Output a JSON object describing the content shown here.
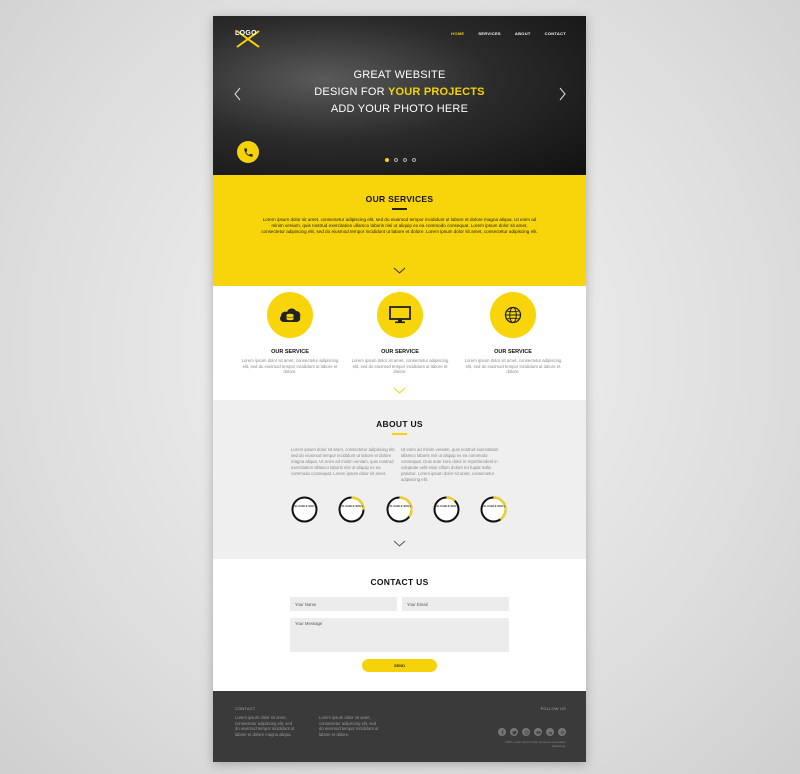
{
  "brand": {
    "logo_text": "LOGO"
  },
  "nav": {
    "items": [
      "HOME",
      "SERVICES",
      "ABOUT",
      "CONTACT"
    ],
    "active": "HOME"
  },
  "hero": {
    "line1": "GREAT WEBSITE",
    "line2_prefix": "DESIGN FOR ",
    "line2_highlight": "YOUR PROJECTS",
    "line3": "ADD YOUR PHOTO HERE",
    "prev_icon": "chevron-left-icon",
    "next_icon": "chevron-right-icon",
    "phone_icon": "phone-icon",
    "slides": 4,
    "active_slide": 1
  },
  "services": {
    "title": "OUR SERVICES",
    "text": "Lorem ipsum dolor sit amet, consectetur adipiscing elit, sed do eiusmod tempor incididunt ut labore et dolore magna aliqua. Ut enim ad minim veniam, quis nostrud exercitation ullamco laboris nisi ut aliquip ex ea commodo consequat. Lorem ipsum dolor sit amet, consectetur adipiscing elit, sed do eiusmod tempor incididunt ut labore et dolore. Lorem ipsum dolor sit amet, consectetur adipiscing elit.",
    "items": [
      {
        "icon": "cloud-database-icon",
        "title": "OUR SERVICE",
        "text": "Lorem ipsum dolor sit amet, consectetur adipiscing elit, sed do eiusmod tempor incididunt ut labore et dolore."
      },
      {
        "icon": "monitor-icon",
        "title": "OUR SERVICE",
        "text": "Lorem ipsum dolor sit amet, consectetur adipiscing elit, sed do eiusmod tempor incididunt ut labore et dolore."
      },
      {
        "icon": "globe-icon",
        "title": "OUR SERVICE",
        "text": "Lorem ipsum dolor sit amet, consectetur adipiscing elit, sed do eiusmod tempor incididunt ut labore et dolore."
      }
    ]
  },
  "about": {
    "title": "ABOUT US",
    "col1": "Lorem ipsum dolor sit amet, consectetur adipiscing elit, sed do eiusmod tempor incididunt ut labore et dolore magna aliqua. Ut enim ad minim veniam, quis nostrud exercitation ullamco laboris nisi ut aliquip ex ea commodo consequat. Lorem ipsum dolor sit amet.",
    "col2": "Ut enim ad minim veniam, quis nostrud exercitation ullamco laboris nisi ut aliquip ex ea commodo consequat. Duis aute irure dolor in reprehenderit in voluptate velit esse cillum dolore eu fugiat nulla pariatur. Lorem ipsum dolor sit amet, consectetur adipiscing elit.",
    "skills": [
      {
        "label": "VALUABLE SKILL",
        "percent": 0
      },
      {
        "label": "VALUABLE SKILL",
        "percent": 25
      },
      {
        "label": "VALUABLE SKILL",
        "percent": 35
      },
      {
        "label": "VALUABLE SKILL",
        "percent": 12
      },
      {
        "label": "VALUABLE SKILL",
        "percent": 40
      }
    ]
  },
  "contact": {
    "title": "CONTACT US",
    "name_placeholder": "Your Name",
    "email_placeholder": "Your Email",
    "message_placeholder": "Your Message",
    "send_label": "SEND"
  },
  "footer": {
    "contact_title": "CONTACT",
    "col1": "Lorem ipsum dolor sit amet, consectetur adipiscing elit, sed do eiusmod tempor incididunt ut labore et dolore magna aliqua.",
    "col2": "Lorem ipsum dolor sit amet, consectetur adipiscing elit, sed do eiusmod tempor incididunt ut labore et dolore.",
    "follow_title": "FOLLOW US",
    "social_icons": [
      "facebook-icon",
      "twitter-icon",
      "instagram-icon",
      "youtube-icon",
      "linkedin-icon",
      "skype-icon"
    ],
    "copyright": "2020. Lorem ipsum dolor sit amet consectetur adipiscing."
  },
  "colors": {
    "accent": "#f8d50a",
    "hero_bg": "#1a1a1a",
    "about_bg": "#efefef",
    "footer_bg": "#3a3a3a",
    "skill_ring": "#111111"
  }
}
